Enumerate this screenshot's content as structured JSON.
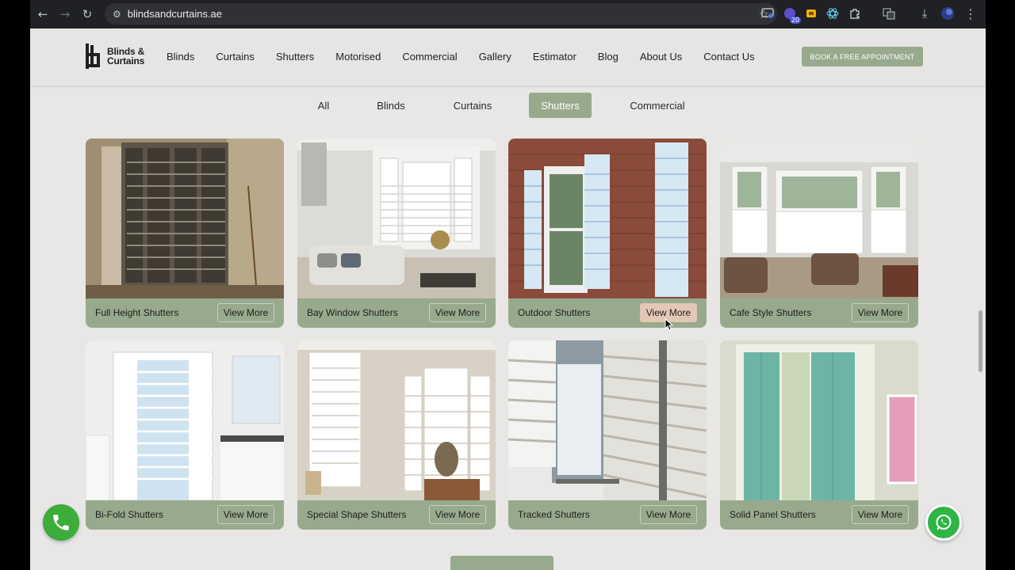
{
  "browser": {
    "url": "blindsandcurtains.ae",
    "back_glyph": "←",
    "forward_glyph": "→",
    "reload_glyph": "↻",
    "site_info_glyph": "⚙",
    "bookmark_glyph": "☆",
    "ext_badge": "20",
    "menu_glyph": "⋮",
    "download_glyph": "⤓"
  },
  "header": {
    "logo_text_line1": "Blinds &",
    "logo_text_line2": "Curtains",
    "menu": [
      "Blinds",
      "Curtains",
      "Shutters",
      "Motorised",
      "Commercial",
      "Gallery",
      "Estimator",
      "Blog",
      "About Us",
      "Contact Us"
    ],
    "cta": "BOOK A FREE APPOINTMENT"
  },
  "filters": {
    "items": [
      "All",
      "Blinds",
      "Curtains",
      "Shutters",
      "Commercial"
    ],
    "active": "Shutters"
  },
  "gallery": {
    "view_label": "View More",
    "cards": [
      {
        "title": "Full Height Shutters"
      },
      {
        "title": "Bay Window Shutters"
      },
      {
        "title": "Outdoor Shutters"
      },
      {
        "title": "Cafe Style Shutters"
      },
      {
        "title": "Bi-Fold Shutters"
      },
      {
        "title": "Special Shape Shutters"
      },
      {
        "title": "Tracked Shutters"
      },
      {
        "title": "Solid Panel Shutters"
      }
    ]
  },
  "colors": {
    "accent": "#98aa8d",
    "hover_button": "#e3c7b4",
    "page_bg": "#e8e7e5",
    "call_green": "#3cac3b",
    "whatsapp_green": "#2fb546"
  }
}
